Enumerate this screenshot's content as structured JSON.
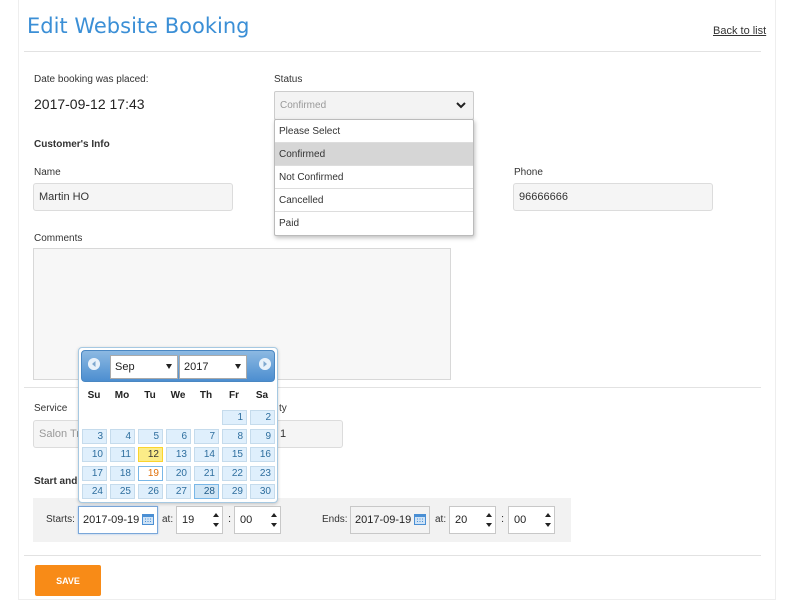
{
  "header": {
    "title": "Edit Website Booking",
    "back_link": "Back to list"
  },
  "booking": {
    "date_placed_label": "Date booking was placed:",
    "date_placed": "2017-09-12 17:43",
    "status_label": "Status",
    "status_value": "Confirmed",
    "status_options": [
      "Please Select",
      "Confirmed",
      "Not Confirmed",
      "Cancelled",
      "Paid"
    ]
  },
  "customer": {
    "section_title": "Customer's Info",
    "name_label": "Name",
    "name_value": "Martin HO",
    "phone_label": "Phone",
    "phone_value": "96666666",
    "comments_label": "Comments",
    "comments_value": ""
  },
  "service": {
    "service_label": "Service",
    "service_value": "Salon Tre",
    "qty_label": "ty",
    "qty_value": "1"
  },
  "schedule": {
    "section_title": "Start and",
    "starts_label": "Starts:",
    "start_date": "2017-09-19",
    "at_label": "at:",
    "start_hour": "19",
    "colon": ":",
    "start_minute": "00",
    "ends_label": "Ends:",
    "end_date": "2017-09-19",
    "end_hour": "20",
    "end_minute": "00"
  },
  "datepicker": {
    "month": "Sep",
    "year": "2017",
    "weekdays": [
      "Su",
      "Mo",
      "Tu",
      "We",
      "Th",
      "Fr",
      "Sa"
    ],
    "first_weekday_index": 5,
    "days_in_month": 30,
    "today": 12,
    "selected": 19,
    "hovered": 28
  },
  "actions": {
    "save_label": "SAVE"
  },
  "colors": {
    "title_blue": "#3b8fd6",
    "save_orange": "#f88b17",
    "calendar_today": "#fbec88"
  }
}
